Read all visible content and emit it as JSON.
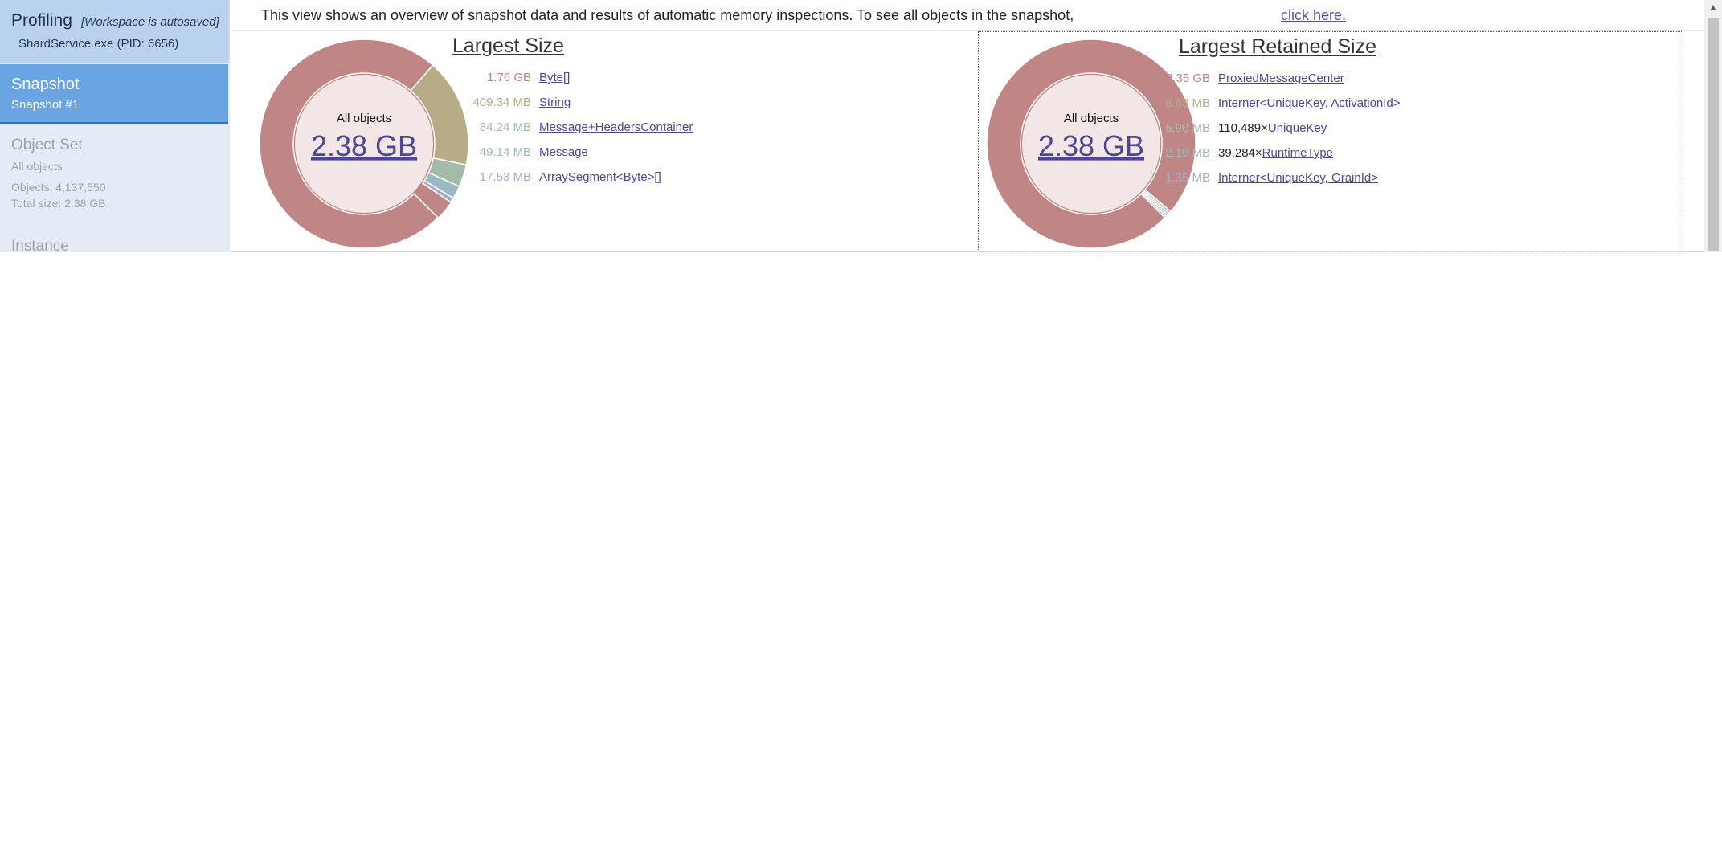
{
  "sidebar": {
    "profiling": {
      "title": "Profiling",
      "note": "[Workspace is autosaved]",
      "process": "ShardService.exe (PID: 6656)"
    },
    "snapshot": {
      "title": "Snapshot",
      "subtitle": "Snapshot #1"
    },
    "object_set": {
      "title": "Object Set",
      "name": "All objects",
      "objects": "Objects: 4,137,550",
      "total_size": "Total size: 2.38 GB"
    },
    "instance": {
      "title": "Instance"
    }
  },
  "infobar": {
    "text": "This view shows an overview of snapshot data and results of automatic memory inspections. To see all objects in the snapshot,",
    "link": "click here."
  },
  "colors": {
    "donut_main": "#c08585",
    "donut_inner": "#f2e6e6",
    "series": [
      "#c08585",
      "#b6ad86",
      "#a3bba8",
      "#9bb9c3",
      "#a6abcb",
      "#8fa0c9"
    ]
  },
  "chart_data": [
    {
      "type": "pie",
      "title": "Largest Size",
      "center_label": "All objects",
      "center_value": "2.38 GB",
      "total_gb": 2.38,
      "items": [
        {
          "size_label": "1.76 GB",
          "size_mb": 1802.24,
          "name": "Byte[]",
          "count": ""
        },
        {
          "size_label": "409.34 MB",
          "size_mb": 409.34,
          "name": "String",
          "count": ""
        },
        {
          "size_label": "84.24 MB",
          "size_mb": 84.24,
          "name": "Message+HeadersContainer",
          "count": ""
        },
        {
          "size_label": "49.14 MB",
          "size_mb": 49.14,
          "name": "Message",
          "count": ""
        },
        {
          "size_label": "17.53 MB",
          "size_mb": 17.53,
          "name": "ArraySegment<Byte>[]",
          "count": ""
        }
      ]
    },
    {
      "type": "pie",
      "title": "Largest Retained Size",
      "center_label": "All objects",
      "center_value": "2.38 GB",
      "total_gb": 2.38,
      "items": [
        {
          "size_label": "2.35 GB",
          "size_mb": 2406.4,
          "name": "ProxiedMessageCenter",
          "count": ""
        },
        {
          "size_label": "8.63 MB",
          "size_mb": 8.63,
          "name": "Interner<UniqueKey, ActivationId>",
          "count": ""
        },
        {
          "size_label": "5.90 MB",
          "size_mb": 5.9,
          "name": "UniqueKey",
          "count": "110,489×"
        },
        {
          "size_label": "2.10 MB",
          "size_mb": 2.1,
          "name": "RuntimeType",
          "count": "39,284×"
        },
        {
          "size_label": "1.35 MB",
          "size_mb": 1.35,
          "name": "Interner<UniqueKey, GrainId>",
          "count": ""
        }
      ]
    }
  ]
}
